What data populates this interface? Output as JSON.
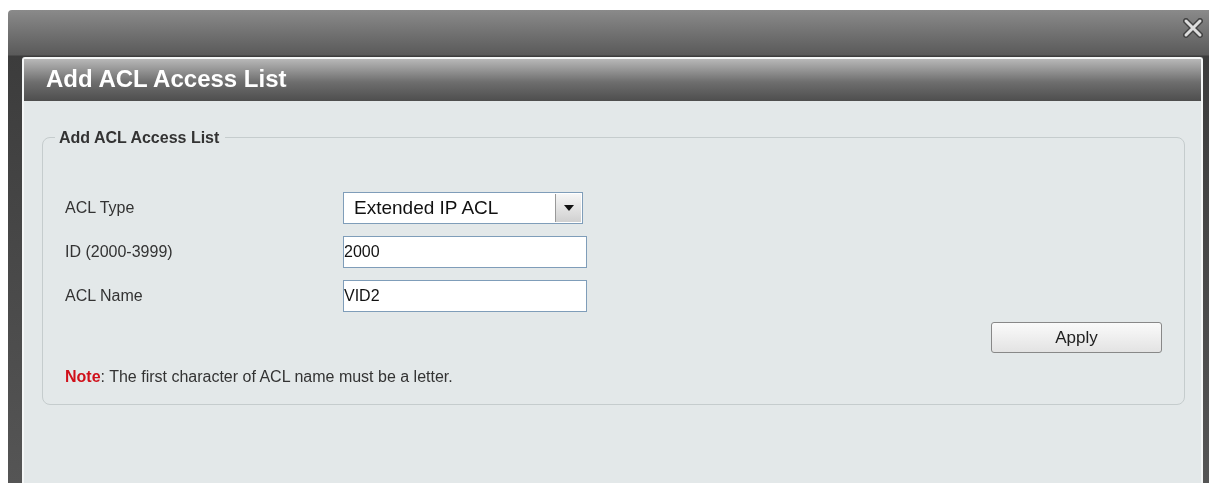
{
  "dialog": {
    "title": "Add ACL Access List"
  },
  "fieldset": {
    "legend": "Add ACL Access List",
    "fields": [
      {
        "kind": "select",
        "label": "ACL Type",
        "value": "Extended IP ACL"
      },
      {
        "kind": "text",
        "label": "ID (2000-3999)",
        "value": "2000"
      },
      {
        "kind": "text",
        "label": "ACL Name",
        "value": "VID2"
      }
    ],
    "apply_button": "Apply",
    "note": "**Note**:  The first character of ACL name must be a letter."
  }
}
